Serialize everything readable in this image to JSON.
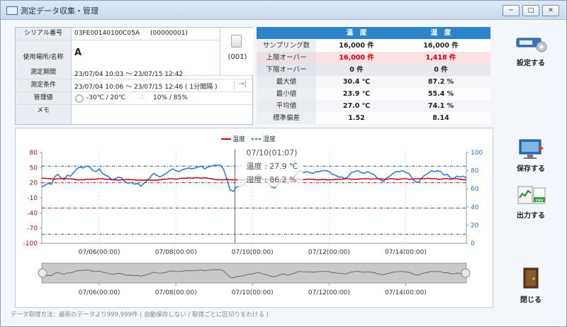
{
  "window": {
    "title": "測定データ収集・管理",
    "btn_min": "─",
    "btn_max": "□",
    "btn_close": "✕"
  },
  "info": {
    "serial_label": "シリアル番号",
    "serial_value": "03FE00140100C05A",
    "serial_sub": "(00000001)",
    "location_label": "使用場所/名称",
    "location_value": "A",
    "device_no": "(001)",
    "period_label": "測定期間",
    "period_value": "23/07/04 10:03 ～ 23/07/15 12:42",
    "cond_label": "測定条件",
    "cond_value": "23/07/04 10:06 ～ 23/07/15 12:46 ( 1分間隔 )",
    "mgmt_label": "管理値",
    "mgmt_temp": "-30℃ / 20℃",
    "mgmt_hum": "10% / 85%",
    "memo_label": "メモ"
  },
  "stats": {
    "header": [
      "",
      "温　度",
      "湿　度"
    ],
    "rows": [
      {
        "label": "サンプリング数",
        "temp": "16,000 件",
        "hum": "16,000 件",
        "kind": "normal"
      },
      {
        "label": "上限オーバー",
        "temp": "16,000 件",
        "hum": "1,418 件",
        "kind": "upper"
      },
      {
        "label": "下限オーバー",
        "temp": "0 件",
        "hum": "0 件",
        "kind": "lower"
      },
      {
        "label": "最大値",
        "temp": "30.4 ℃",
        "hum": "87.2 %",
        "kind": "normal"
      },
      {
        "label": "最小値",
        "temp": "23.9 ℃",
        "hum": "55.4 %",
        "kind": "normal"
      },
      {
        "label": "平均値",
        "temp": "27.0 ℃",
        "hum": "74.1 %",
        "kind": "normal"
      },
      {
        "label": "標準偏差",
        "temp": "1.52",
        "hum": "8.14",
        "kind": "normal"
      }
    ]
  },
  "sidebar": {
    "settings": "設定する",
    "save": "保存する",
    "output": "出力する",
    "close": "閉じる",
    "csv": "csv"
  },
  "chart_data": {
    "type": "line",
    "legend": [
      "温度",
      "湿度"
    ],
    "legend_placement": "top-center",
    "y_left": {
      "ticks": [
        "80",
        "50",
        "20",
        "-10",
        "-40",
        "-70",
        "-100"
      ],
      "ylim": [
        -100,
        80
      ]
    },
    "y_right": {
      "ticks": [
        "100",
        "80",
        "60",
        "40",
        "20",
        "0"
      ],
      "ylim": [
        0,
        100
      ]
    },
    "x_ticks": [
      "07/06(00:00)",
      "07/08(00:00)",
      "07/10(00:00)",
      "07/12(00:00)",
      "07/14(00:00)"
    ],
    "thresholds": {
      "temp_upper": 20,
      "temp_lower": -30,
      "hum_upper": 85,
      "hum_lower": 10
    },
    "series": [
      {
        "name": "温度",
        "color": "#c0101c",
        "x": [
          0,
          2,
          4,
          6,
          8,
          10,
          12,
          14,
          16,
          18,
          20,
          22,
          24,
          26,
          28,
          30,
          32,
          34,
          36,
          38,
          40,
          42,
          44,
          46,
          48,
          50,
          52,
          54,
          56,
          58,
          60,
          62,
          64,
          66,
          68,
          70,
          72,
          74,
          76,
          78,
          80,
          82,
          84,
          86,
          88,
          90,
          92,
          94,
          96,
          98,
          100,
          102,
          104,
          106,
          108,
          110,
          112,
          114,
          116,
          118,
          120,
          122,
          124,
          126,
          128,
          130,
          132,
          134,
          136,
          138,
          140,
          142,
          144,
          146,
          148,
          150,
          152,
          154,
          156,
          158,
          160,
          162,
          164,
          166,
          168,
          170,
          172,
          174,
          176,
          178,
          180,
          182,
          184,
          186,
          188,
          190,
          192,
          194,
          196,
          198,
          200,
          202,
          204,
          206,
          208,
          210,
          212,
          214,
          216,
          218,
          220,
          222,
          224,
          226,
          228,
          230,
          232,
          234,
          236,
          238,
          240,
          242,
          244,
          246,
          248,
          250,
          252,
          254,
          256,
          258,
          260,
          262,
          264,
          266
        ],
        "y": [
          29,
          29,
          28,
          28,
          27,
          28,
          28,
          29,
          28,
          28,
          27,
          26,
          26,
          26,
          27,
          27,
          27,
          27,
          28,
          28,
          27,
          27,
          26,
          26,
          25,
          26,
          26,
          27,
          26,
          26,
          25,
          25,
          25,
          26,
          25,
          25,
          25,
          26,
          27,
          27,
          28,
          28,
          27,
          28,
          29,
          29,
          30,
          29,
          30,
          30,
          29,
          30,
          29,
          28,
          27,
          26,
          26,
          26,
          27,
          26,
          26,
          26,
          25,
          25,
          26,
          26,
          27,
          27,
          27,
          27,
          26,
          26,
          26,
          27,
          27,
          28,
          27,
          27,
          27,
          27,
          27,
          26,
          26,
          27,
          27,
          27,
          26,
          26,
          27,
          26,
          26,
          26,
          27,
          27,
          27,
          28,
          28,
          27,
          27,
          27,
          28,
          28,
          28,
          27,
          28,
          28,
          28,
          27,
          27,
          28,
          28,
          27,
          27,
          28,
          28,
          27,
          27,
          28,
          28,
          28,
          28,
          29,
          28,
          28,
          27,
          27,
          28,
          28,
          27,
          28,
          28,
          27,
          26,
          26
        ]
      },
      {
        "name": "湿度",
        "color": "#2f7fd8",
        "x": [
          0,
          2,
          4,
          6,
          8,
          10,
          12,
          14,
          16,
          18,
          20,
          22,
          24,
          26,
          28,
          30,
          32,
          34,
          36,
          38,
          40,
          42,
          44,
          46,
          48,
          50,
          52,
          54,
          56,
          58,
          60,
          62,
          64,
          66,
          68,
          70,
          72,
          74,
          76,
          78,
          80,
          82,
          84,
          86,
          88,
          90,
          92,
          94,
          96,
          98,
          100,
          102,
          104,
          106,
          108,
          110,
          112,
          114,
          116,
          118,
          120,
          122,
          124,
          126,
          128,
          130,
          132,
          134,
          136,
          138,
          140,
          142,
          144,
          146,
          148,
          150,
          152,
          154,
          156,
          158,
          160,
          162,
          164,
          166,
          168,
          170,
          172,
          174,
          176,
          178,
          180,
          182,
          184,
          186,
          188,
          190,
          192,
          194,
          196,
          198,
          200,
          202,
          204,
          206,
          208,
          210,
          212,
          214,
          216,
          218,
          220,
          222,
          224,
          226,
          228,
          230,
          232,
          234,
          236,
          238,
          240,
          242,
          244,
          246,
          248,
          250,
          252,
          254,
          256,
          258,
          260,
          262,
          264,
          266
        ],
        "y": [
          62,
          64,
          66,
          65,
          73,
          76,
          72,
          70,
          75,
          74,
          78,
          82,
          84,
          83,
          85,
          84,
          80,
          79,
          82,
          77,
          75,
          73,
          70,
          71,
          73,
          72,
          68,
          66,
          67,
          65,
          66,
          63,
          66,
          69,
          73,
          77,
          75,
          73,
          75,
          77,
          80,
          82,
          80,
          79,
          81,
          82,
          83,
          82,
          83,
          84,
          85,
          82,
          84,
          85,
          86,
          86,
          86,
          81,
          70,
          59,
          57,
          62,
          63,
          64,
          68,
          70,
          71,
          74,
          76,
          72,
          69,
          66,
          62,
          61,
          66,
          70,
          71,
          66,
          70,
          73,
          78,
          80,
          78,
          79,
          78,
          77,
          79,
          79,
          80,
          80,
          79,
          76,
          75,
          73,
          73,
          71,
          74,
          78,
          79,
          80,
          78,
          77,
          79,
          77,
          76,
          72,
          70,
          68,
          72,
          74,
          77,
          79,
          79,
          80,
          78,
          77,
          72,
          68,
          67,
          72,
          75,
          77,
          80,
          79,
          80,
          79,
          75,
          76,
          72,
          71,
          74,
          73,
          74,
          72
        ]
      }
    ],
    "tooltip": {
      "time": "07/10(01:07)",
      "temp": "温度 : 27.9 ℃",
      "hum": "湿度 : 86.2 %"
    },
    "x_range_hours": [
      0,
      266
    ]
  },
  "status": "データ取得方法：最新のデータより999,999件 ( 自動保存しない / 取得ごとに区切りをわける )"
}
